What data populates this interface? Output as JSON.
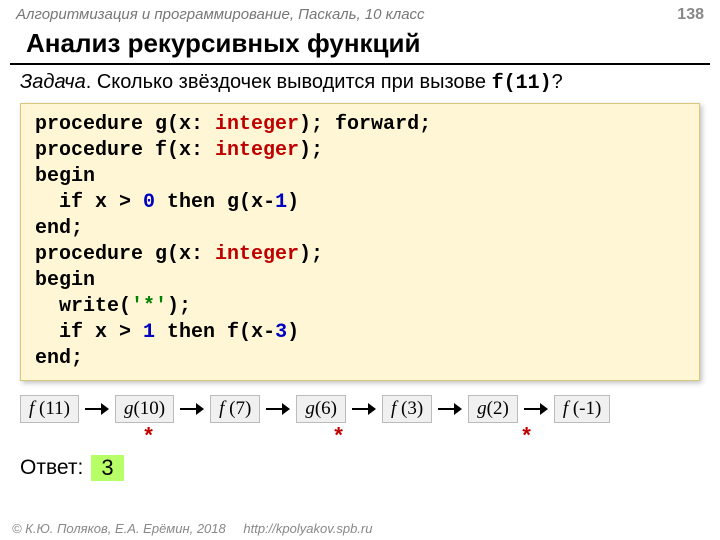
{
  "header": {
    "course": "Алгоритмизация и программирование, Паскаль, 10 класс",
    "page": "138"
  },
  "title": "Анализ рекурсивных функций",
  "task": {
    "label": "Задача",
    "text": ". Сколько звёздочек выводится при вызове ",
    "call": "f(11)",
    "q": "?"
  },
  "code": {
    "l1a": "procedure g(x: ",
    "l1b": "integer",
    "l1c": "); forward;",
    "l2a": "procedure f(x: ",
    "l2b": "integer",
    "l2c": ");",
    "l3": "begin",
    "l4a": "  if x > ",
    "l4b": "0",
    "l4c": " then g(x-",
    "l4d": "1",
    "l4e": ")",
    "l5": "end;",
    "l6a": "procedure g(x: ",
    "l6b": "integer",
    "l6c": ");",
    "l7": "begin",
    "l8a": "  write(",
    "l8b": "'*'",
    "l8c": ");",
    "l9a": "  if x > ",
    "l9b": "1",
    "l9c": " then f(x-",
    "l9d": "3",
    "l9e": ")",
    "l10": "end;"
  },
  "trace": {
    "c1f": "f ",
    "c1a": "(11)",
    "c2f": "g",
    "c2a": "(10)",
    "c3f": "f ",
    "c3a": "(7)",
    "c4f": "g",
    "c4a": "(6)",
    "c5f": "f ",
    "c5a": "(3)",
    "c6f": "g",
    "c6a": "(2)",
    "c7f": "f ",
    "c7a": "(-1)"
  },
  "stars": {
    "s1": "*",
    "s2": "*",
    "s3": "*"
  },
  "answer": {
    "label": "Ответ:",
    "value": "3"
  },
  "footer": {
    "copyright": "© К.Ю. Поляков, Е.А. Ерёмин, 2018",
    "url": "http://kpolyakov.spb.ru"
  }
}
